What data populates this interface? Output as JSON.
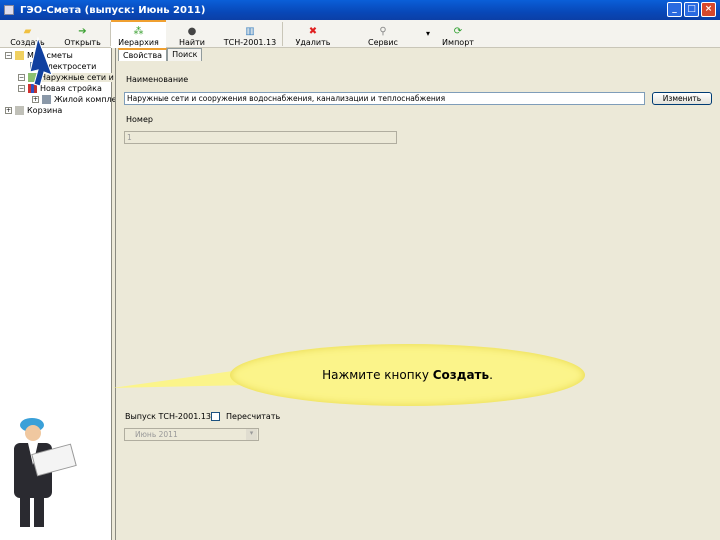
{
  "window": {
    "title": "ГЭО-Смета (выпуск: Июнь 2011)"
  },
  "toolbar": {
    "items": [
      {
        "label": "Создать",
        "icon": "new-document-icon",
        "color": "#f0c040"
      },
      {
        "label": "Открыть",
        "icon": "arrow-right-icon",
        "color": "#3aa030"
      },
      {
        "label": "Иерархия",
        "icon": "hierarchy-icon",
        "color": "#3aa030"
      },
      {
        "label": "Найти",
        "icon": "binoculars-icon",
        "color": "#444444"
      },
      {
        "label": "ТСН-2001.13",
        "icon": "chart-icon",
        "color": "#3a80c0"
      },
      {
        "label": "Удалить",
        "icon": "delete-x-icon",
        "color": "#e02020"
      },
      {
        "label": "Сервис",
        "icon": "wrench-icon",
        "color": "#888888"
      },
      {
        "label": "Импорт",
        "icon": "refresh-icon",
        "color": "#30a030"
      }
    ]
  },
  "tree": {
    "items": [
      {
        "label": "Мои сметы",
        "icon": "folder-icon"
      },
      {
        "label": "Электросети",
        "icon": "document-icon"
      },
      {
        "label": "Наружные сети и",
        "icon": "arrow-document-icon"
      },
      {
        "label": "Новая стройка",
        "icon": "chart-icon"
      },
      {
        "label": "Жилой компле",
        "icon": "computer-icon"
      },
      {
        "label": "Корзина",
        "icon": "trash-icon"
      }
    ]
  },
  "tabs": [
    {
      "label": "Свойства"
    },
    {
      "label": "Поиск"
    }
  ],
  "form": {
    "name_label": "Наименование",
    "name_value": "Наружные сети и сооружения водоснабжения, канализации и теплоснабжения",
    "change_button": "Изменить",
    "number_label": "Номер",
    "number_value": "1",
    "release_label": "Выпуск ТСН-2001.13",
    "recalc_label": "Пересчитать",
    "release_value": "Июнь 2011"
  },
  "callout": {
    "text_prefix": "Нажмите кнопку ",
    "text_bold": "Создать",
    "text_suffix": "."
  }
}
